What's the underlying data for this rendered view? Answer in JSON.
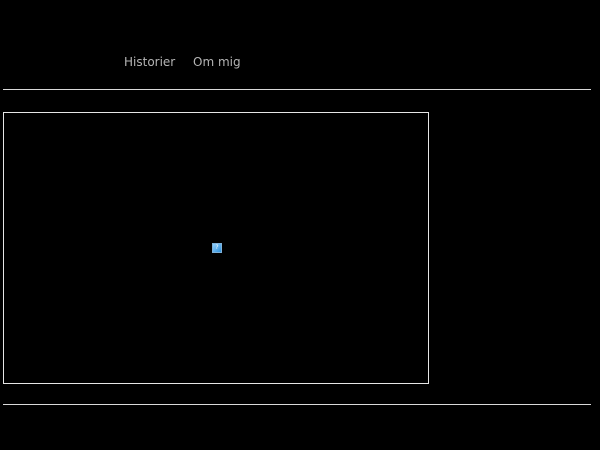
{
  "nav": {
    "items": [
      {
        "label": "Historier"
      },
      {
        "label": "Om mig"
      }
    ]
  },
  "main": {
    "media_placeholder": {
      "icon": "broken-image-icon",
      "glyph": "?"
    }
  },
  "colors": {
    "background": "#000000",
    "nav_text": "#b4b4b4",
    "rule": "#d9d9d9",
    "frame_border": "#e6e6e6"
  }
}
